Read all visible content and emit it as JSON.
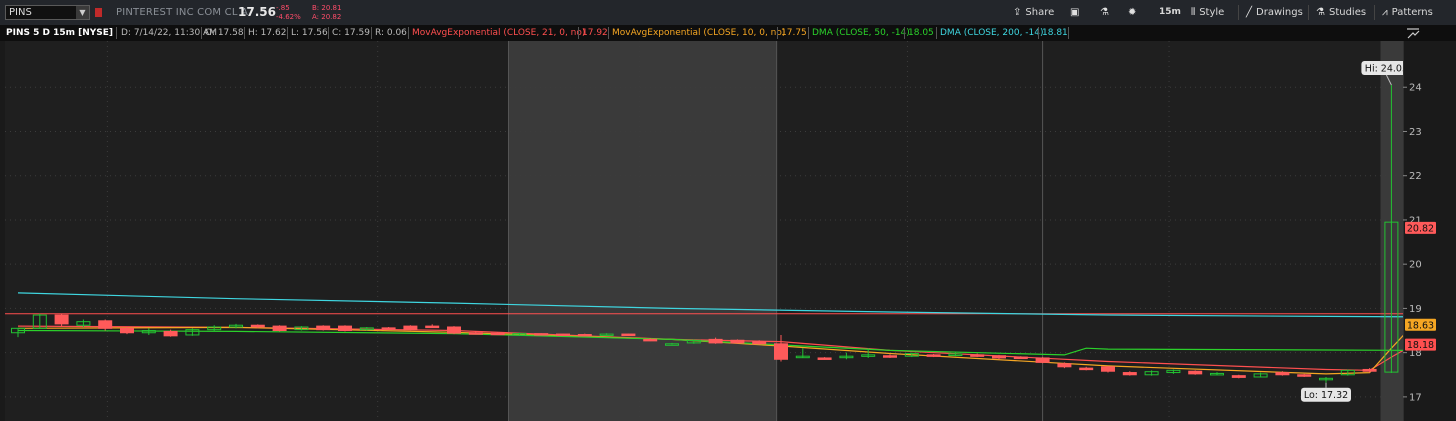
{
  "toolbar": {
    "symbol": "PINS",
    "company": "PINTEREST INC COM CL A",
    "last": "17.56",
    "change": "-.85",
    "change_pct": "-4.62%",
    "bid": "B: 20.81",
    "ask": "A: 20.82",
    "share_label": "Share",
    "interval_label": "15m",
    "style_label": "Style",
    "drawings_label": "Drawings",
    "studies_label": "Studies",
    "patterns_label": "Patterns"
  },
  "infobar": {
    "title": "PINS 5 D 15m [NYSE]",
    "date": "D: 7/14/22, 11:30 AM",
    "open": "O: 17.58",
    "high": "H: 17.62",
    "low": "L: 17.56",
    "close": "C: 17.59",
    "range": "R: 0.06",
    "ema21_label": "MovAvgExponential (CLOSE, 21, 0, no)",
    "ema21_value": "17.92",
    "ema10_label": "MovAvgExponential (CLOSE, 10, 0, no)",
    "ema10_value": "17.75",
    "dma50_label": "DMA (CLOSE, 50, -14)",
    "dma50_value": "18.05",
    "dma200_label": "DMA (CLOSE, 200, -14)",
    "dma200_value": "18.81"
  },
  "colors": {
    "up": "#22c232",
    "down": "#ff5a5a",
    "ema21": "#ff4f4f",
    "ema10": "#f5a623",
    "dma50": "#2bd12b",
    "dma200": "#3fd6e0"
  },
  "chart_data": {
    "type": "candlestick",
    "title": "PINS 5 D 15m [NYSE]",
    "ylim": [
      16.5,
      25.0
    ],
    "y_ticks": [
      17,
      18,
      19,
      20,
      21,
      22,
      23,
      24
    ],
    "grid": true,
    "reference_line": 18.88,
    "shaded_regions": [
      [
        22.5,
        34.8
      ],
      [
        62.5,
        63.8
      ]
    ],
    "candles": [
      {
        "i": 0,
        "o": 18.45,
        "h": 18.55,
        "l": 18.35,
        "c": 18.55
      },
      {
        "i": 1,
        "o": 18.55,
        "h": 18.88,
        "l": 18.55,
        "c": 18.85
      },
      {
        "i": 2,
        "o": 18.85,
        "h": 18.88,
        "l": 18.6,
        "c": 18.65
      },
      {
        "i": 3,
        "o": 18.62,
        "h": 18.75,
        "l": 18.58,
        "c": 18.7
      },
      {
        "i": 4,
        "o": 18.72,
        "h": 18.75,
        "l": 18.5,
        "c": 18.55
      },
      {
        "i": 5,
        "o": 18.55,
        "h": 18.58,
        "l": 18.42,
        "c": 18.45
      },
      {
        "i": 6,
        "o": 18.45,
        "h": 18.55,
        "l": 18.4,
        "c": 18.5
      },
      {
        "i": 7,
        "o": 18.48,
        "h": 18.52,
        "l": 18.36,
        "c": 18.38
      },
      {
        "i": 8,
        "o": 18.4,
        "h": 18.55,
        "l": 18.38,
        "c": 18.52
      },
      {
        "i": 9,
        "o": 18.52,
        "h": 18.62,
        "l": 18.48,
        "c": 18.58
      },
      {
        "i": 10,
        "o": 18.58,
        "h": 18.65,
        "l": 18.55,
        "c": 18.62
      },
      {
        "i": 11,
        "o": 18.62,
        "h": 18.64,
        "l": 18.55,
        "c": 18.6
      },
      {
        "i": 12,
        "o": 18.6,
        "h": 18.62,
        "l": 18.48,
        "c": 18.5
      },
      {
        "i": 13,
        "o": 18.52,
        "h": 18.6,
        "l": 18.5,
        "c": 18.58
      },
      {
        "i": 14,
        "o": 18.6,
        "h": 18.62,
        "l": 18.5,
        "c": 18.52
      },
      {
        "i": 15,
        "o": 18.6,
        "h": 18.62,
        "l": 18.48,
        "c": 18.5
      },
      {
        "i": 16,
        "o": 18.52,
        "h": 18.58,
        "l": 18.5,
        "c": 18.56
      },
      {
        "i": 17,
        "o": 18.56,
        "h": 18.58,
        "l": 18.52,
        "c": 18.54
      },
      {
        "i": 18,
        "o": 18.6,
        "h": 18.62,
        "l": 18.5,
        "c": 18.52
      },
      {
        "i": 19,
        "o": 18.6,
        "h": 18.64,
        "l": 18.56,
        "c": 18.58
      },
      {
        "i": 20,
        "o": 18.58,
        "h": 18.6,
        "l": 18.42,
        "c": 18.44
      },
      {
        "i": 21,
        "o": 18.45,
        "h": 18.48,
        "l": 18.42,
        "c": 18.44
      },
      {
        "i": 22,
        "o": 18.44,
        "h": 18.46,
        "l": 18.4,
        "c": 18.42
      },
      {
        "i": 23,
        "o": 18.43,
        "h": 18.45,
        "l": 18.41,
        "c": 18.43
      },
      {
        "i": 24,
        "o": 18.43,
        "h": 18.44,
        "l": 18.41,
        "c": 18.42
      },
      {
        "i": 25,
        "o": 18.42,
        "h": 18.43,
        "l": 18.4,
        "c": 18.41
      },
      {
        "i": 26,
        "o": 18.41,
        "h": 18.43,
        "l": 18.39,
        "c": 18.4
      },
      {
        "i": 27,
        "o": 18.42,
        "h": 18.44,
        "l": 18.4,
        "c": 18.42
      },
      {
        "i": 28,
        "o": 18.42,
        "h": 18.43,
        "l": 18.4,
        "c": 18.41
      },
      {
        "i": 29,
        "o": 18.3,
        "h": 18.32,
        "l": 18.26,
        "c": 18.28
      },
      {
        "i": 30,
        "o": 18.2,
        "h": 18.22,
        "l": 18.18,
        "c": 18.2
      },
      {
        "i": 31,
        "o": 18.22,
        "h": 18.3,
        "l": 18.2,
        "c": 18.28
      },
      {
        "i": 32,
        "o": 18.3,
        "h": 18.34,
        "l": 18.2,
        "c": 18.22
      },
      {
        "i": 33,
        "o": 18.28,
        "h": 18.3,
        "l": 18.2,
        "c": 18.22
      },
      {
        "i": 34,
        "o": 18.25,
        "h": 18.28,
        "l": 18.18,
        "c": 18.2
      },
      {
        "i": 35,
        "o": 18.2,
        "h": 18.4,
        "l": 17.8,
        "c": 17.85
      },
      {
        "i": 36,
        "o": 17.9,
        "h": 18.1,
        "l": 17.88,
        "c": 17.92
      },
      {
        "i": 37,
        "o": 17.88,
        "h": 17.9,
        "l": 17.85,
        "c": 17.87
      },
      {
        "i": 38,
        "o": 17.9,
        "h": 18.0,
        "l": 17.85,
        "c": 17.92
      },
      {
        "i": 39,
        "o": 17.92,
        "h": 18.1,
        "l": 17.88,
        "c": 17.95
      },
      {
        "i": 40,
        "o": 17.93,
        "h": 17.96,
        "l": 17.88,
        "c": 17.9
      },
      {
        "i": 41,
        "o": 17.92,
        "h": 18.0,
        "l": 17.9,
        "c": 17.98
      },
      {
        "i": 42,
        "o": 17.95,
        "h": 17.97,
        "l": 17.9,
        "c": 17.92
      },
      {
        "i": 43,
        "o": 17.95,
        "h": 18.0,
        "l": 17.92,
        "c": 17.97
      },
      {
        "i": 44,
        "o": 17.95,
        "h": 17.98,
        "l": 17.9,
        "c": 17.92
      },
      {
        "i": 45,
        "o": 17.93,
        "h": 17.95,
        "l": 17.85,
        "c": 17.88
      },
      {
        "i": 46,
        "o": 17.9,
        "h": 17.92,
        "l": 17.86,
        "c": 17.88
      },
      {
        "i": 47,
        "o": 17.88,
        "h": 17.9,
        "l": 17.76,
        "c": 17.78
      },
      {
        "i": 48,
        "o": 17.75,
        "h": 17.78,
        "l": 17.65,
        "c": 17.68
      },
      {
        "i": 49,
        "o": 17.65,
        "h": 17.68,
        "l": 17.6,
        "c": 17.62
      },
      {
        "i": 50,
        "o": 17.68,
        "h": 17.7,
        "l": 17.55,
        "c": 17.58
      },
      {
        "i": 51,
        "o": 17.55,
        "h": 17.58,
        "l": 17.48,
        "c": 17.5
      },
      {
        "i": 52,
        "o": 17.5,
        "h": 17.6,
        "l": 17.48,
        "c": 17.57
      },
      {
        "i": 53,
        "o": 17.55,
        "h": 17.62,
        "l": 17.52,
        "c": 17.6
      },
      {
        "i": 54,
        "o": 17.58,
        "h": 17.6,
        "l": 17.5,
        "c": 17.52
      },
      {
        "i": 55,
        "o": 17.52,
        "h": 17.56,
        "l": 17.5,
        "c": 17.53
      },
      {
        "i": 56,
        "o": 17.48,
        "h": 17.5,
        "l": 17.42,
        "c": 17.44
      },
      {
        "i": 57,
        "o": 17.45,
        "h": 17.55,
        "l": 17.44,
        "c": 17.52
      },
      {
        "i": 58,
        "o": 17.55,
        "h": 17.58,
        "l": 17.48,
        "c": 17.5
      },
      {
        "i": 59,
        "o": 17.5,
        "h": 17.52,
        "l": 17.45,
        "c": 17.47
      },
      {
        "i": 60,
        "o": 17.4,
        "h": 17.45,
        "l": 17.32,
        "c": 17.42
      },
      {
        "i": 61,
        "o": 17.5,
        "h": 17.62,
        "l": 17.48,
        "c": 17.6
      },
      {
        "i": 62,
        "o": 17.62,
        "h": 17.65,
        "l": 17.55,
        "c": 17.58
      },
      {
        "i": 63,
        "o": 17.56,
        "h": 24.05,
        "l": 17.54,
        "c": 20.95
      },
      {
        "i": 64,
        "o": 20.95,
        "h": 21.0,
        "l": 20.78,
        "c": 20.82
      }
    ],
    "series": [
      {
        "name": "MovAvgExponential (CLOSE, 21, 0, no)",
        "key": "ema21",
        "x": [
          0,
          10,
          20,
          30,
          35,
          40,
          50,
          60,
          62,
          63,
          64
        ],
        "values": [
          18.6,
          18.57,
          18.5,
          18.3,
          18.25,
          18.05,
          17.8,
          17.62,
          17.6,
          17.9,
          18.18
        ]
      },
      {
        "name": "MovAvgExponential (CLOSE, 10, 0, no)",
        "key": "ema10",
        "x": [
          0,
          10,
          20,
          30,
          35,
          40,
          50,
          60,
          62,
          63,
          64
        ],
        "values": [
          18.55,
          18.57,
          18.46,
          18.3,
          18.15,
          17.98,
          17.7,
          17.52,
          17.55,
          18.1,
          18.63
        ]
      },
      {
        "name": "DMA (CLOSE, 50, -14)",
        "key": "dma50",
        "x": [
          0,
          10,
          20,
          30,
          36,
          40,
          48,
          49,
          50,
          60,
          64
        ],
        "values": [
          18.5,
          18.48,
          18.43,
          18.3,
          18.15,
          18.05,
          17.95,
          18.1,
          18.08,
          18.06,
          18.05
        ]
      },
      {
        "name": "DMA (CLOSE, 200, -14)",
        "key": "dma200",
        "x": [
          0,
          10,
          20,
          30,
          40,
          50,
          60,
          64
        ],
        "values": [
          19.35,
          19.22,
          19.12,
          19.0,
          18.92,
          18.85,
          18.82,
          18.81
        ]
      }
    ],
    "annotations": [
      {
        "text": "Hi: 24.05",
        "x": 63,
        "y": 24.05
      },
      {
        "text": "Lo: 17.32",
        "x": 60,
        "y": 17.32
      }
    ],
    "price_labels": [
      {
        "text": "20.82",
        "key": "down",
        "y": 20.82
      },
      {
        "text": "18.63",
        "key": "ema10",
        "y": 18.63
      },
      {
        "text": "18.18",
        "key": "ema21",
        "y": 18.18
      }
    ]
  }
}
